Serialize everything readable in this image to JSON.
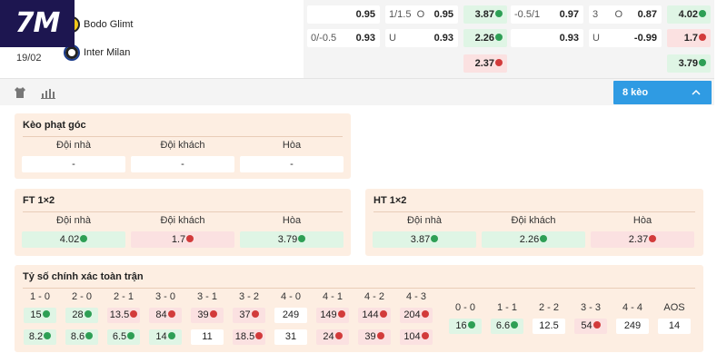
{
  "logo": {
    "text": "7M"
  },
  "match": {
    "date": "19/02",
    "home": "Bodo Glimt",
    "away": "Inter Milan"
  },
  "odds_row1": [
    {
      "label": "",
      "value": "0.95",
      "trend": ""
    },
    {
      "label": "1/1.5  O",
      "value": "0.95",
      "trend": ""
    },
    {
      "label": "",
      "value": "3.87",
      "trend": "up"
    },
    {
      "label": "-0.5/1",
      "value": "0.97",
      "trend": ""
    },
    {
      "label": "3      O",
      "value": "0.87",
      "trend": ""
    },
    {
      "label": "",
      "value": "4.02",
      "trend": "up"
    }
  ],
  "odds_row2": [
    {
      "label": "0/-0.5",
      "value": "0.93",
      "trend": ""
    },
    {
      "label": "U",
      "value": "0.93",
      "trend": ""
    },
    {
      "label": "",
      "value": "2.26",
      "trend": "up"
    },
    {
      "label": "",
      "value": "0.93",
      "trend": ""
    },
    {
      "label": "U",
      "value": "-0.99",
      "trend": ""
    },
    {
      "label": "",
      "value": "1.7",
      "trend": "down"
    }
  ],
  "odds_row3": [
    {
      "label": "",
      "value": "2.37",
      "trend": "down"
    },
    {
      "label": "",
      "value": "3.79",
      "trend": "up"
    }
  ],
  "toolbar": {
    "icons": [
      "shirt-icon",
      "bar-chart-icon"
    ],
    "more_label": "8 kèo",
    "chevron": "chevron-up-icon"
  },
  "corner": {
    "title": "Kèo phạt góc",
    "headers": [
      "Đội nhà",
      "Đội khách",
      "Hòa"
    ],
    "values": [
      {
        "value": "-",
        "trend": ""
      },
      {
        "value": "-",
        "trend": ""
      },
      {
        "value": "-",
        "trend": ""
      }
    ]
  },
  "ft": {
    "title": "FT 1×2",
    "headers": [
      "Đội nhà",
      "Đội khách",
      "Hòa"
    ],
    "values": [
      {
        "value": "4.02",
        "trend": "up"
      },
      {
        "value": "1.7",
        "trend": "down"
      },
      {
        "value": "3.79",
        "trend": "up"
      }
    ]
  },
  "ht": {
    "title": "HT 1×2",
    "headers": [
      "Đội nhà",
      "Đội khách",
      "Hòa"
    ],
    "values": [
      {
        "value": "3.87",
        "trend": "up"
      },
      {
        "value": "2.26",
        "trend": "up"
      },
      {
        "value": "2.37",
        "trend": "down"
      }
    ]
  },
  "correct_score": {
    "title": "Tỷ số chính xác toàn trận",
    "home_wins": [
      {
        "score": "1 - 0",
        "row1": {
          "value": "15",
          "trend": "up"
        },
        "row2": {
          "value": "8.2",
          "trend": "up"
        }
      },
      {
        "score": "2 - 0",
        "row1": {
          "value": "28",
          "trend": "up"
        },
        "row2": {
          "value": "8.6",
          "trend": "up"
        }
      },
      {
        "score": "2 - 1",
        "row1": {
          "value": "13.5",
          "trend": "down"
        },
        "row2": {
          "value": "6.5",
          "trend": "up"
        }
      },
      {
        "score": "3 - 0",
        "row1": {
          "value": "84",
          "trend": "down"
        },
        "row2": {
          "value": "14",
          "trend": "up"
        }
      },
      {
        "score": "3 - 1",
        "row1": {
          "value": "39",
          "trend": "down"
        },
        "row2": {
          "value": "11",
          "trend": ""
        }
      },
      {
        "score": "3 - 2",
        "row1": {
          "value": "37",
          "trend": "down"
        },
        "row2": {
          "value": "18.5",
          "trend": "down"
        }
      },
      {
        "score": "4 - 0",
        "row1": {
          "value": "249",
          "trend": ""
        },
        "row2": {
          "value": "31",
          "trend": ""
        }
      },
      {
        "score": "4 - 1",
        "row1": {
          "value": "149",
          "trend": "down"
        },
        "row2": {
          "value": "24",
          "trend": "down"
        }
      },
      {
        "score": "4 - 2",
        "row1": {
          "value": "144",
          "trend": "down"
        },
        "row2": {
          "value": "39",
          "trend": "down"
        }
      },
      {
        "score": "4 - 3",
        "row1": {
          "value": "204",
          "trend": "down"
        },
        "row2": {
          "value": "104",
          "trend": "down"
        }
      }
    ],
    "draws": [
      {
        "score": "0 - 0",
        "value": "16",
        "trend": "up"
      },
      {
        "score": "1 - 1",
        "value": "6.6",
        "trend": "up"
      },
      {
        "score": "2 - 2",
        "value": "12.5",
        "trend": ""
      },
      {
        "score": "3 - 3",
        "value": "54",
        "trend": "down"
      },
      {
        "score": "4 - 4",
        "value": "249",
        "trend": ""
      },
      {
        "score": "AOS",
        "value": "14",
        "trend": ""
      }
    ]
  },
  "colors": {
    "up": "#2e9f55",
    "down": "#d23b3b",
    "accent": "#2f9be3",
    "panel": "#fdeee2"
  }
}
